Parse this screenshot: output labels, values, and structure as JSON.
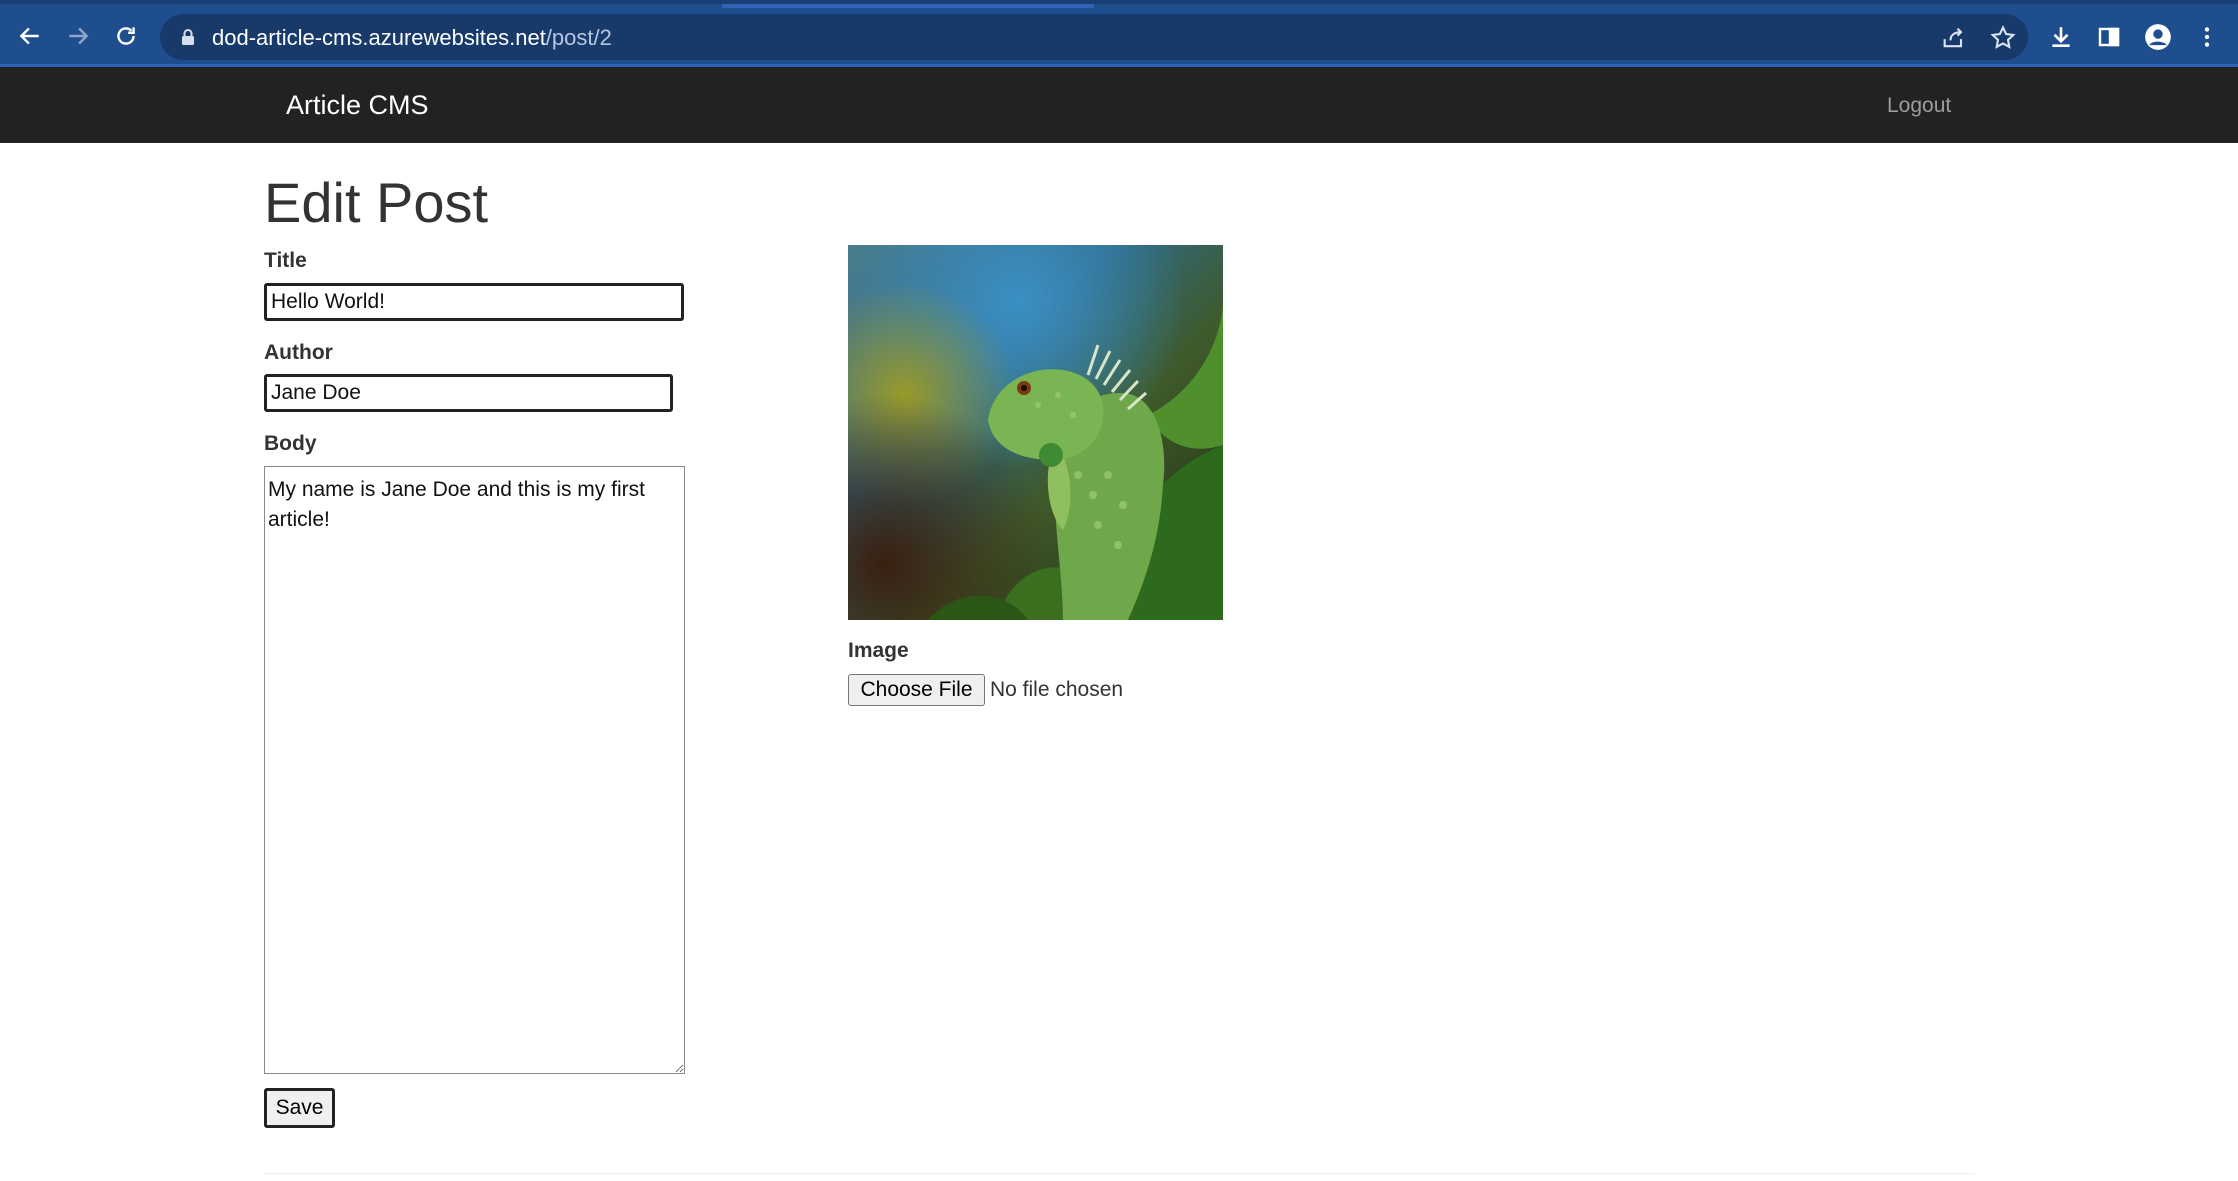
{
  "browser": {
    "url_host": "dod-article-cms.azurewebsites.net",
    "url_path": "/post/2"
  },
  "navbar": {
    "brand": "Article CMS",
    "logout": "Logout"
  },
  "page": {
    "title": "Edit Post"
  },
  "form": {
    "title_label": "Title",
    "title_value": "Hello World!",
    "author_label": "Author",
    "author_value": "Jane Doe",
    "body_label": "Body",
    "body_value": "My name is Jane Doe and this is my first article!",
    "image_label": "Image",
    "choose_file": "Choose File",
    "file_status": "No file chosen",
    "save": "Save"
  },
  "colors": {
    "browser_chrome": "#1f4e8f",
    "navbar": "#222222"
  }
}
